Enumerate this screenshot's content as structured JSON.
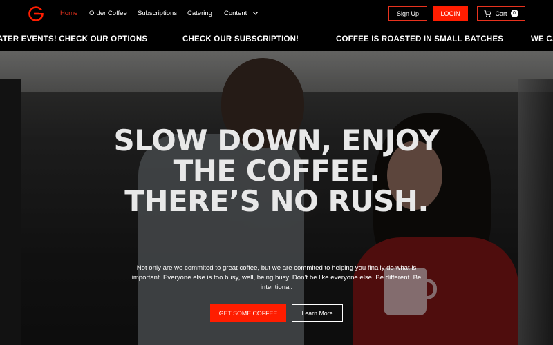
{
  "brand": {
    "logo_icon": "g-logo-icon",
    "accent_color": "#ff1d00"
  },
  "nav": {
    "items": [
      {
        "label": "Home",
        "active": true
      },
      {
        "label": "Order Coffee",
        "active": false
      },
      {
        "label": "Subscriptions",
        "active": false
      },
      {
        "label": "Catering",
        "active": false
      },
      {
        "label": "Content",
        "active": false,
        "icon": "chevron-down-icon"
      }
    ],
    "signup_label": "Sign Up",
    "login_label": "LOGIN",
    "cart_label": "Cart",
    "cart_icon": "cart-icon",
    "cart_count": "0"
  },
  "ticker": {
    "items": [
      "ATER EVENTS! CHECK OUR OPTIONS",
      "CHECK OUR SUBSCRIPTION!",
      "COFFEE IS ROASTED IN SMALL BATCHES",
      "WE CA"
    ]
  },
  "hero": {
    "headline": "SLOW DOWN, ENJOY THE COFFEE. THERE’S NO RUSH.",
    "subtext": "Not only are we commited to great coffee, but we are commited to helping you finally do what is important. Everyone else is too busy, well, being busy. Don’t be like everyone else. Be different. Be intentional.",
    "primary_cta": "GET SOME COFFEE",
    "secondary_cta": "Learn More"
  }
}
